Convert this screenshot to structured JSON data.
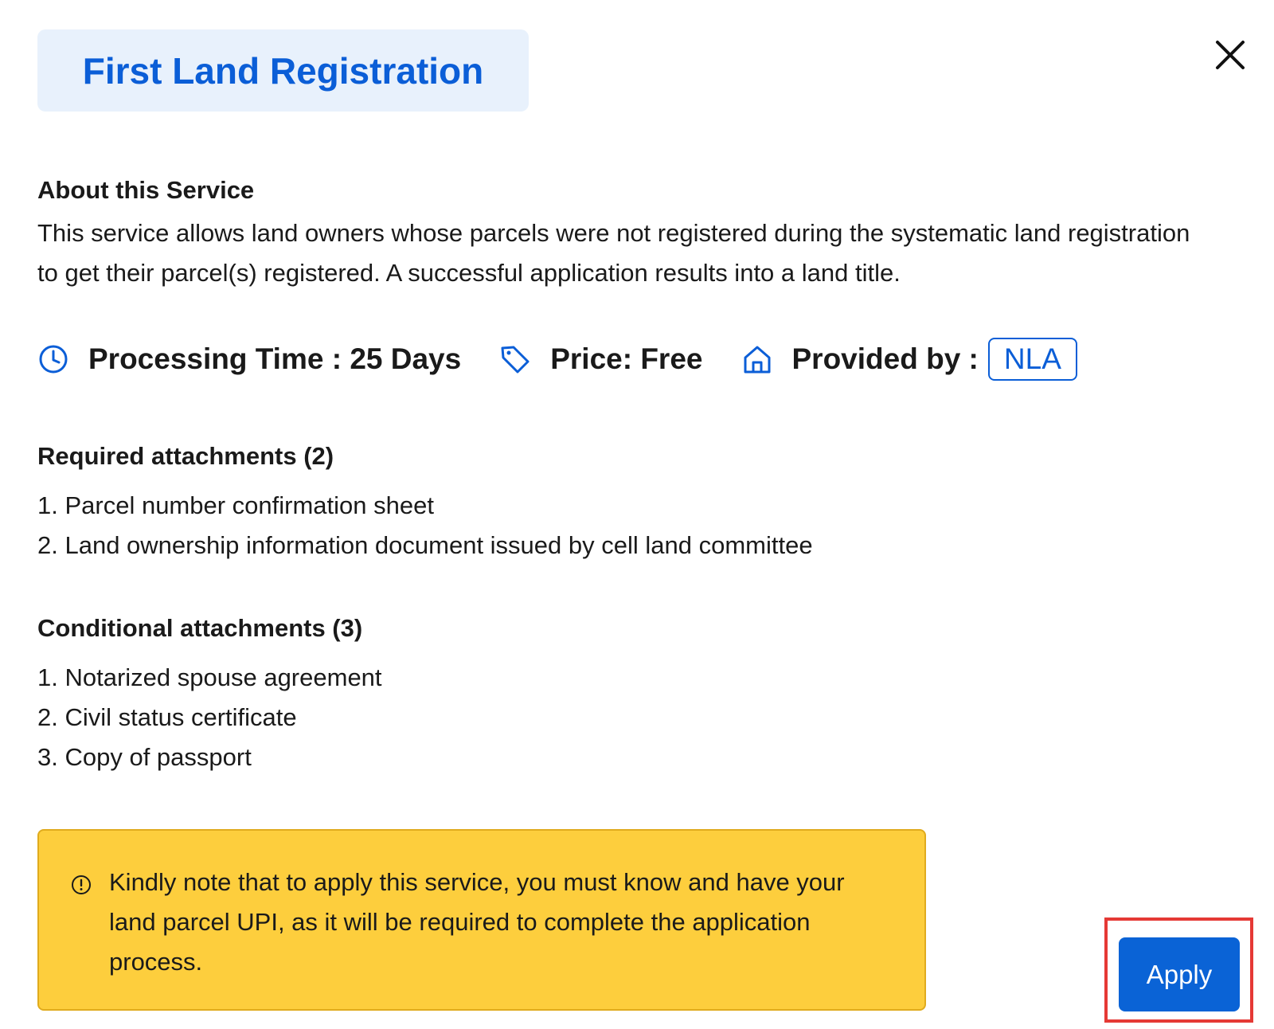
{
  "header": {
    "title": "First Land Registration"
  },
  "about": {
    "heading": "About this Service",
    "description": "This service allows land owners whose parcels were not registered during the systematic land registration to get their parcel(s) registered. A successful application results into a land title."
  },
  "meta": {
    "processing_time": "Processing Time : 25 Days",
    "price": "Price: Free",
    "provided_by_label": "Provided by :",
    "provider": "NLA"
  },
  "required": {
    "heading": "Required attachments (2)",
    "items": [
      "1. Parcel number confirmation sheet",
      "2. Land ownership information document issued by cell land committee"
    ]
  },
  "conditional": {
    "heading": "Conditional attachments (3)",
    "items": [
      "1. Notarized spouse agreement",
      "2. Civil status certificate",
      "3. Copy of passport"
    ]
  },
  "notice": {
    "text": "Kindly note that to apply this service, you must know and have your land parcel UPI, as it will be required to complete the application process."
  },
  "actions": {
    "apply_label": "Apply"
  },
  "colors": {
    "accent": "#0b5ed7",
    "notice_bg": "#fdce3d",
    "highlight": "#e53935",
    "title_bg": "#e8f1fc"
  },
  "icons": [
    "close-icon",
    "clock-icon",
    "price-tag-icon",
    "home-icon",
    "info-icon"
  ]
}
